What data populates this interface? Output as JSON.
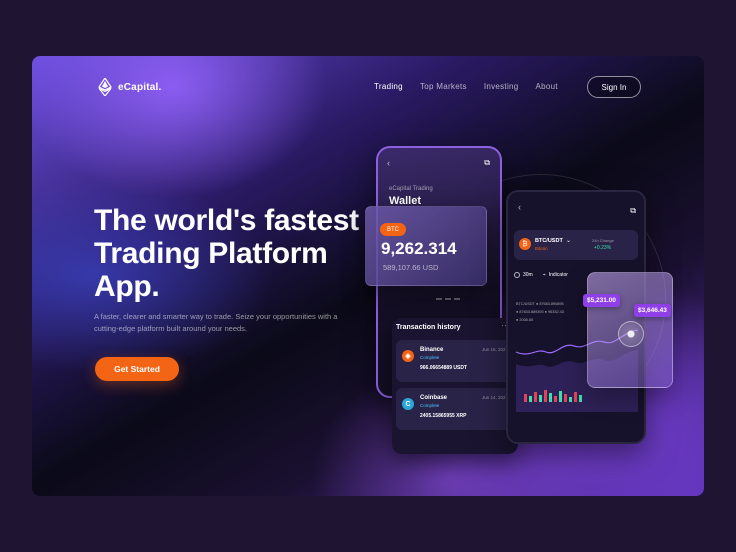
{
  "brand": {
    "name": "eCapital."
  },
  "nav": {
    "links": [
      "Trading",
      "Top Markets",
      "Investing",
      "About"
    ],
    "signin": "Sign In"
  },
  "hero": {
    "title": "The world's fastest Trading Platform App.",
    "subtitle": "A faster, clearer and smarter way to trade. Seize your opportunities with a cutting-edge platform built around your needs.",
    "cta": "Get Started"
  },
  "wallet_phone": {
    "subtitle": "eCapital Trading",
    "title": "Wallet",
    "card": {
      "coin": "BTC",
      "value": "9,262.314",
      "usd": "589,107.66 USD"
    },
    "tx": {
      "title": "Transaction history",
      "items": [
        {
          "name": "Binance",
          "status": "Complete",
          "amount": "966.06654889 USDT",
          "date": "Jun 15, 2021"
        },
        {
          "name": "Coinbase",
          "status": "Complete",
          "amount": "2405.15865955 XRP",
          "date": "Jun 14, 2021"
        }
      ]
    }
  },
  "chart_phone": {
    "pair": "BTC/USDT",
    "pair_sub": "Bitcoin",
    "change_label": "24h Change",
    "change": "+0.23%",
    "tabs": [
      "30m",
      "Indicator"
    ],
    "stats": [
      "BTC/USDT  ● 87683.890895",
      "● 87633.889393  ● 96332.43",
      "● 2008.65"
    ],
    "badges": [
      "$5,231.00",
      "$3,646.43"
    ],
    "accent": "#8f3fe8"
  },
  "colors": {
    "accent": "#f36414",
    "positive": "#3de0a8"
  }
}
